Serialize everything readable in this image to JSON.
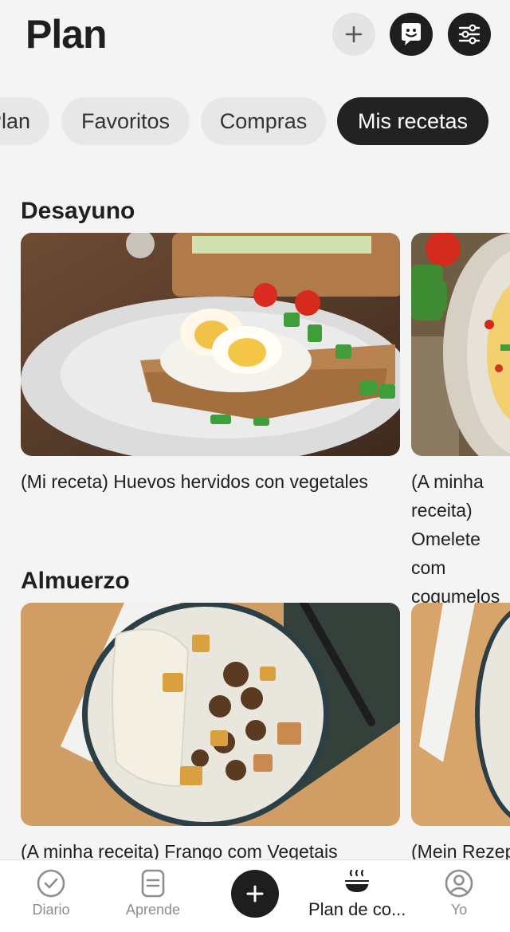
{
  "header": {
    "title": "Plan"
  },
  "tabs": [
    {
      "label": "Plan",
      "active": false
    },
    {
      "label": "Favoritos",
      "active": false
    },
    {
      "label": "Compras",
      "active": false
    },
    {
      "label": "Mis recetas",
      "active": true
    }
  ],
  "sections": [
    {
      "title": "Desayuno",
      "cards": [
        {
          "label": "(Mi receta) Huevos hervidos con vegetales"
        },
        {
          "label": "(A minha receita) Omelete com cogumelos"
        }
      ]
    },
    {
      "title": "Almuerzo",
      "cards": [
        {
          "label": "(A minha receita) Frango com Vegetais"
        },
        {
          "label": "(Mein Rezept)"
        }
      ]
    }
  ],
  "bottom_nav": [
    {
      "label": "Diario",
      "icon": "check-circle-icon",
      "active": false
    },
    {
      "label": "Aprende",
      "icon": "document-icon",
      "active": false
    },
    {
      "label": "",
      "icon": "plus-icon",
      "active": false
    },
    {
      "label": "Plan de co...",
      "icon": "food-bowl-icon",
      "active": true
    },
    {
      "label": "Yo",
      "icon": "profile-icon",
      "active": false
    }
  ]
}
